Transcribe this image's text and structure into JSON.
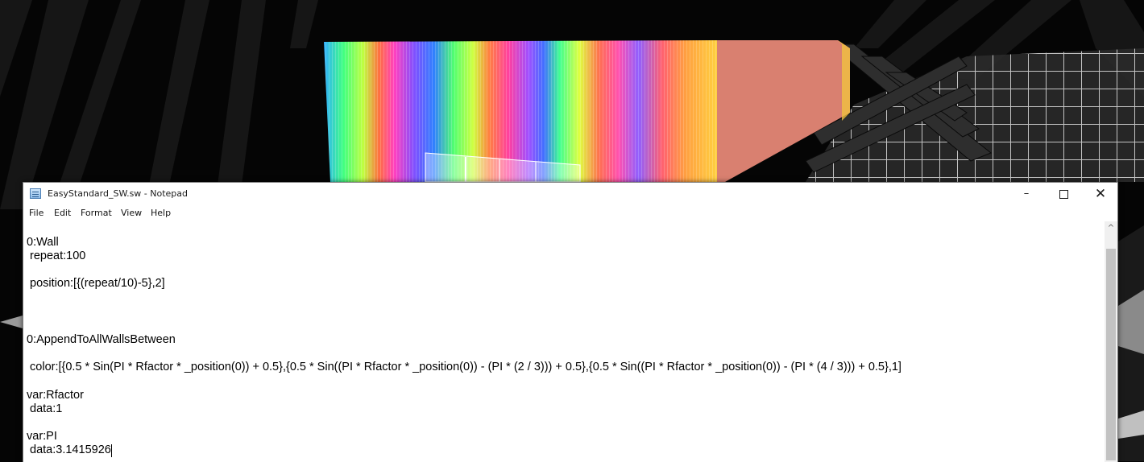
{
  "window": {
    "title": "EasyStandard_SW.sw - Notepad",
    "minimize_glyph": "–",
    "close_glyph": "✕",
    "icon": "notepad-icon"
  },
  "menu": [
    "File",
    "Edit",
    "Format",
    "View",
    "Help"
  ],
  "editor": {
    "lines": [
      "0:Wall",
      " repeat:100",
      "",
      " position:[{(repeat/10)-5},2]",
      "",
      "",
      "",
      "0:AppendToAllWallsBetween",
      "",
      " color:[{0.5 * Sin(PI * Rfactor * _position(0)) + 0.5},{0.5 * Sin((PI * Rfactor * _position(0)) - (PI * (2 / 3))) + 0.5},{0.5 * Sin((PI * Rfactor * _position(0)) - (PI * (4 / 3))) + 0.5},1]",
      "",
      "var:Rfactor",
      " data:1",
      "",
      "var:PI",
      " data:3.1415926"
    ]
  },
  "scrollbar": {
    "up_glyph": "^"
  },
  "colors": {
    "background": "#050505",
    "wall_end": "#d98070",
    "grid_floor": "#4a4a4a"
  }
}
